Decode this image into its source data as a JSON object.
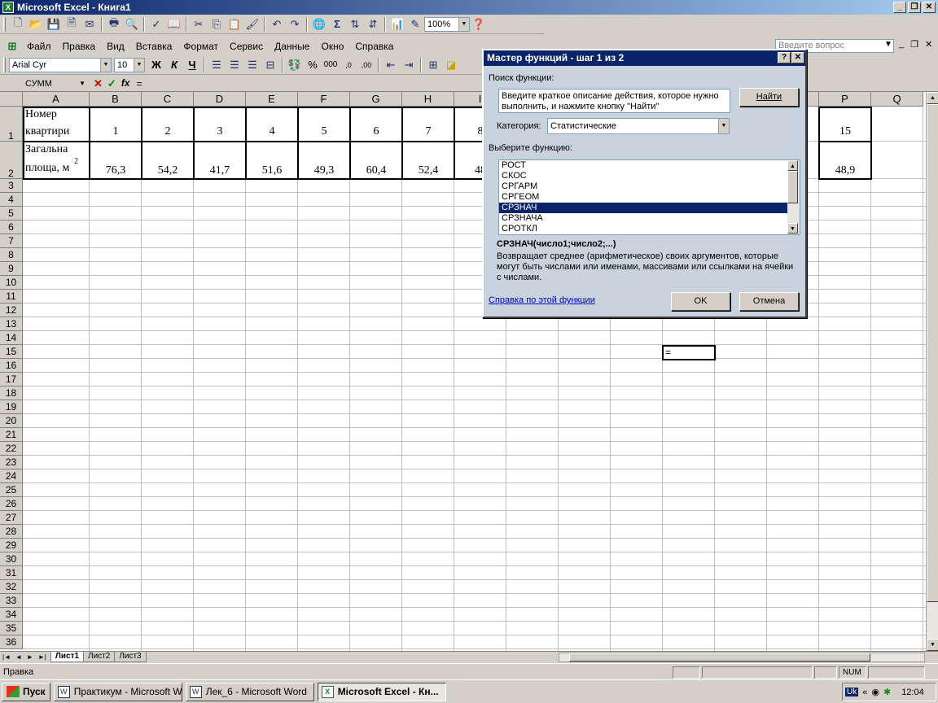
{
  "window": {
    "title": "Microsoft Excel - Книга1",
    "app_icon": "X"
  },
  "toolbar": {
    "zoom": "100%"
  },
  "menu": [
    "Файл",
    "Правка",
    "Вид",
    "Вставка",
    "Формат",
    "Сервис",
    "Данные",
    "Окно",
    "Справка"
  ],
  "ask_question_placeholder": "Введите вопрос",
  "format_toolbar": {
    "font": "Arial Cyr",
    "size": "10"
  },
  "formula_bar": {
    "name_box": "СУММ",
    "formula": "="
  },
  "columns": [
    "A",
    "B",
    "C",
    "D",
    "E",
    "F",
    "G",
    "H",
    "I",
    "P",
    "Q"
  ],
  "table": {
    "row1_label": [
      "Номер",
      "квартири"
    ],
    "row2_label": [
      "Загальна",
      "площа, м"
    ],
    "row2_sup": "2",
    "row1_values": [
      "1",
      "2",
      "3",
      "4",
      "5",
      "6",
      "7",
      "8",
      "15"
    ],
    "row2_values": [
      "76,3",
      "54,2",
      "41,7",
      "51,6",
      "49,3",
      "60,4",
      "52,4",
      "48",
      "48,9"
    ]
  },
  "active_cell_value": "=",
  "sheets": [
    "Лист1",
    "Лист2",
    "Лист3"
  ],
  "status": {
    "mode": "Правка",
    "num": "NUM"
  },
  "taskbar": {
    "start": "Пуск",
    "tasks": [
      "Практикум - Microsoft W...",
      "Лек_6 - Microsoft Word",
      "Microsoft Excel - Кн..."
    ],
    "lang": "Uk",
    "time": "12:04"
  },
  "dialog": {
    "title": "Мастер функций - шаг 1 из 2",
    "search_label": "Поиск функции:",
    "search_text": "Введите краткое описание действия, которое нужно выполнить, и нажмите кнопку \"Найти\"",
    "find_button": "Найти",
    "category_label": "Категория:",
    "category_value": "Статистические",
    "select_label": "Выберите функцию:",
    "functions": [
      "РОСТ",
      "СКОС",
      "СРГАРМ",
      "СРГЕОМ",
      "СРЗНАЧ",
      "СРЗНАЧА",
      "СРОТКЛ"
    ],
    "selected_function": "СРЗНАЧ",
    "signature": "СРЗНАЧ(число1;число2;...)",
    "description": "Возвращает среднее (арифметическое) своих аргументов, которые могут быть числами или именами, массивами или ссылками на ячейки с числами.",
    "help_link": "Справка по этой функции",
    "ok": "OK",
    "cancel": "Отмена"
  }
}
